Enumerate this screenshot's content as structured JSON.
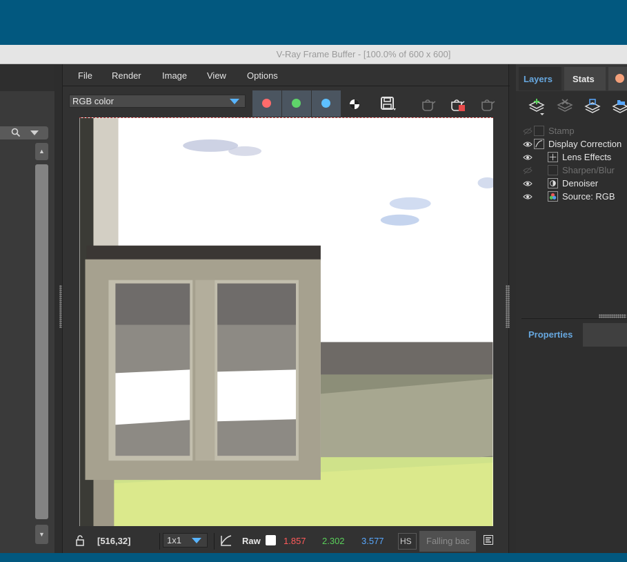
{
  "window": {
    "title": "V-Ray Frame Buffer - [100.0% of 600 x 600]"
  },
  "menu": {
    "items": [
      "File",
      "Render",
      "Image",
      "View",
      "Options"
    ]
  },
  "toolbar": {
    "channel": "RGB color"
  },
  "status": {
    "pixel": "[516,32]",
    "sampling": "1x1",
    "color_space": "Raw",
    "r": "1.857",
    "g": "2.302",
    "b": "3.577",
    "hsv": "HS",
    "ocio": "Falling bac"
  },
  "right_panel": {
    "tabs": [
      "Layers",
      "Stats"
    ],
    "layers": [
      {
        "label": "Stamp",
        "enabled": false,
        "indent": 0
      },
      {
        "label": "Display Correction",
        "enabled": true,
        "indent": 0
      },
      {
        "label": "Lens Effects",
        "enabled": true,
        "indent": 1
      },
      {
        "label": "Sharpen/Blur",
        "enabled": false,
        "indent": 1
      },
      {
        "label": "Denoiser",
        "enabled": true,
        "indent": 1
      },
      {
        "label": "Source: RGB",
        "enabled": true,
        "indent": 1
      }
    ],
    "properties_label": "Properties"
  },
  "colors": {
    "accent": "#58b4ff",
    "tab_active": "#67a8e0",
    "r": "#ff5a5a",
    "g": "#5ad05a",
    "b": "#58a8ff"
  }
}
